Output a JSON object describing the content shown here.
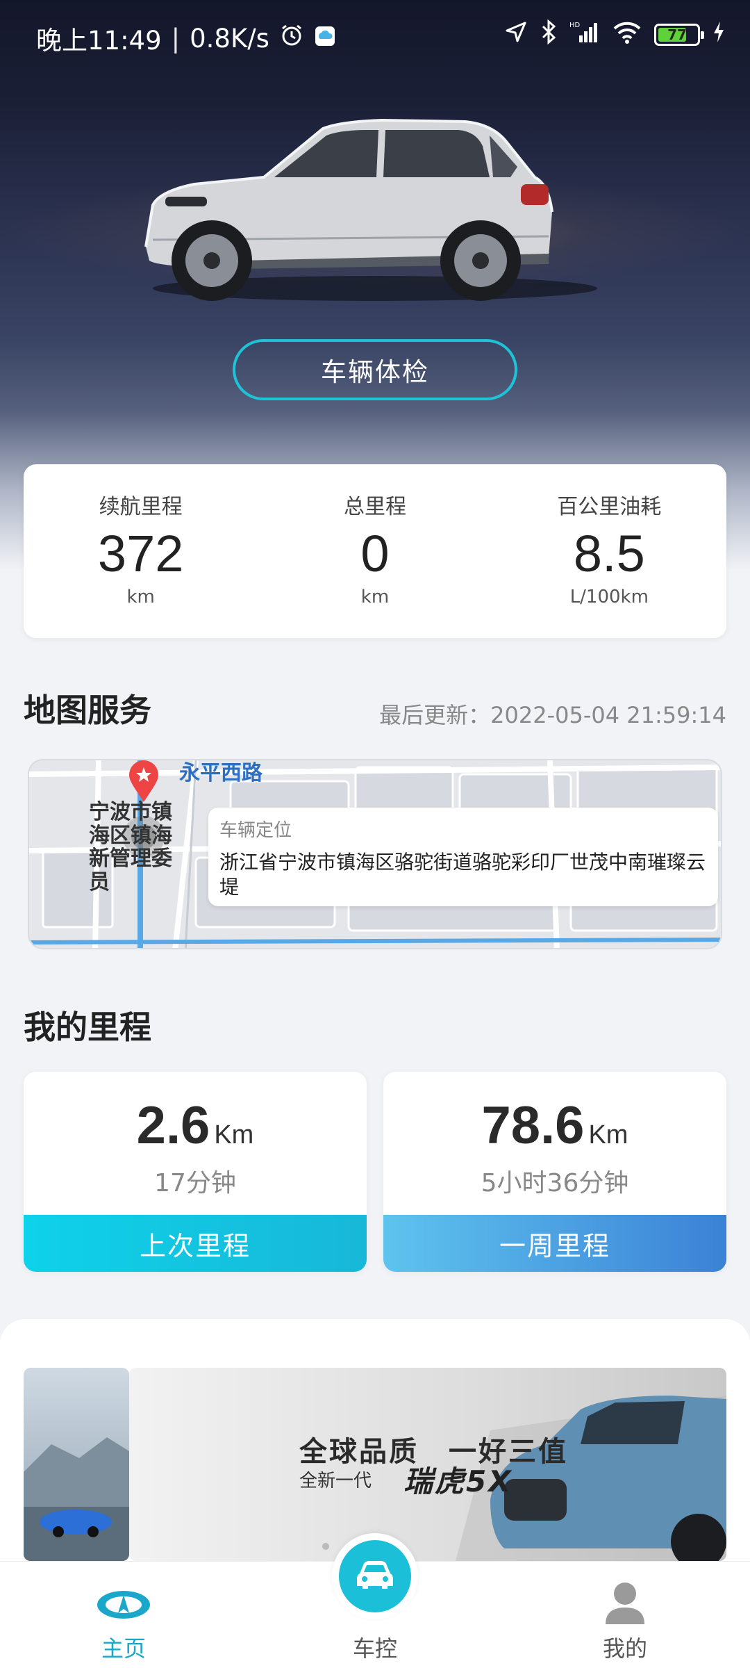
{
  "status_bar": {
    "time": "晚上11:49",
    "speed": "0.8K/s",
    "battery": "77",
    "battery_level": 0.77
  },
  "hero": {
    "check_button": "车辆体检"
  },
  "stats": [
    {
      "label": "续航里程",
      "value": "372",
      "unit": "km"
    },
    {
      "label": "总里程",
      "value": "0",
      "unit": "km"
    },
    {
      "label": "百公里油耗",
      "value": "8.5",
      "unit": "L/100km"
    }
  ],
  "map_service": {
    "title": "地图服务",
    "last_update": "最后更新：2022-05-04 21:59:14",
    "road_label": "永平西路",
    "poi_label": "宁波市镇海区镇海新管理委员",
    "popup_title": "车辆定位",
    "popup_address": "浙江省宁波市镇海区骆驼街道骆驼彩印厂世茂中南璀璨云堤"
  },
  "mileage": {
    "title": "我的里程",
    "cards": [
      {
        "value": "2.6",
        "unit": "Km",
        "duration": "17分钟",
        "label": "上次里程",
        "colors": [
          "#0ed2ea",
          "#18b7d8"
        ]
      },
      {
        "value": "78.6",
        "unit": "Km",
        "duration": "5小时36分钟",
        "label": "一周里程",
        "colors": [
          "#5ec3ee",
          "#3b82d6"
        ]
      }
    ]
  },
  "banner": {
    "slogan": "全球品质　一好三值",
    "prefix": "全新一代",
    "model": "瑞虎5X"
  },
  "tabbar": {
    "home": "主页",
    "control": "车控",
    "mine": "我的"
  },
  "colors": {
    "accent": "#1cbfd8",
    "active_tab": "#1aa7c9"
  }
}
